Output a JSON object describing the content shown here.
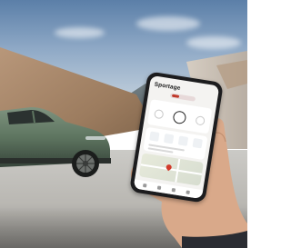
{
  "scene": {
    "description_free": true
  },
  "phone_app": {
    "title": "Sportage",
    "accent_color": "#c0392b",
    "controls": [
      {
        "icon": "lock-icon"
      },
      {
        "icon": "power-icon"
      },
      {
        "icon": "unlock-icon"
      }
    ],
    "tiles": [
      {
        "icon": "climate-icon"
      },
      {
        "icon": "fuel-icon"
      },
      {
        "icon": "car-status-icon"
      },
      {
        "icon": "windows-icon"
      }
    ],
    "map_pin_icon": "location-pin-icon",
    "nav_icons": [
      "home-icon",
      "map-icon",
      "car-icon",
      "menu-icon"
    ]
  },
  "colors": {
    "car_body": "#5e7560",
    "wall": "#a68566",
    "sky": "#8fa9c6"
  }
}
